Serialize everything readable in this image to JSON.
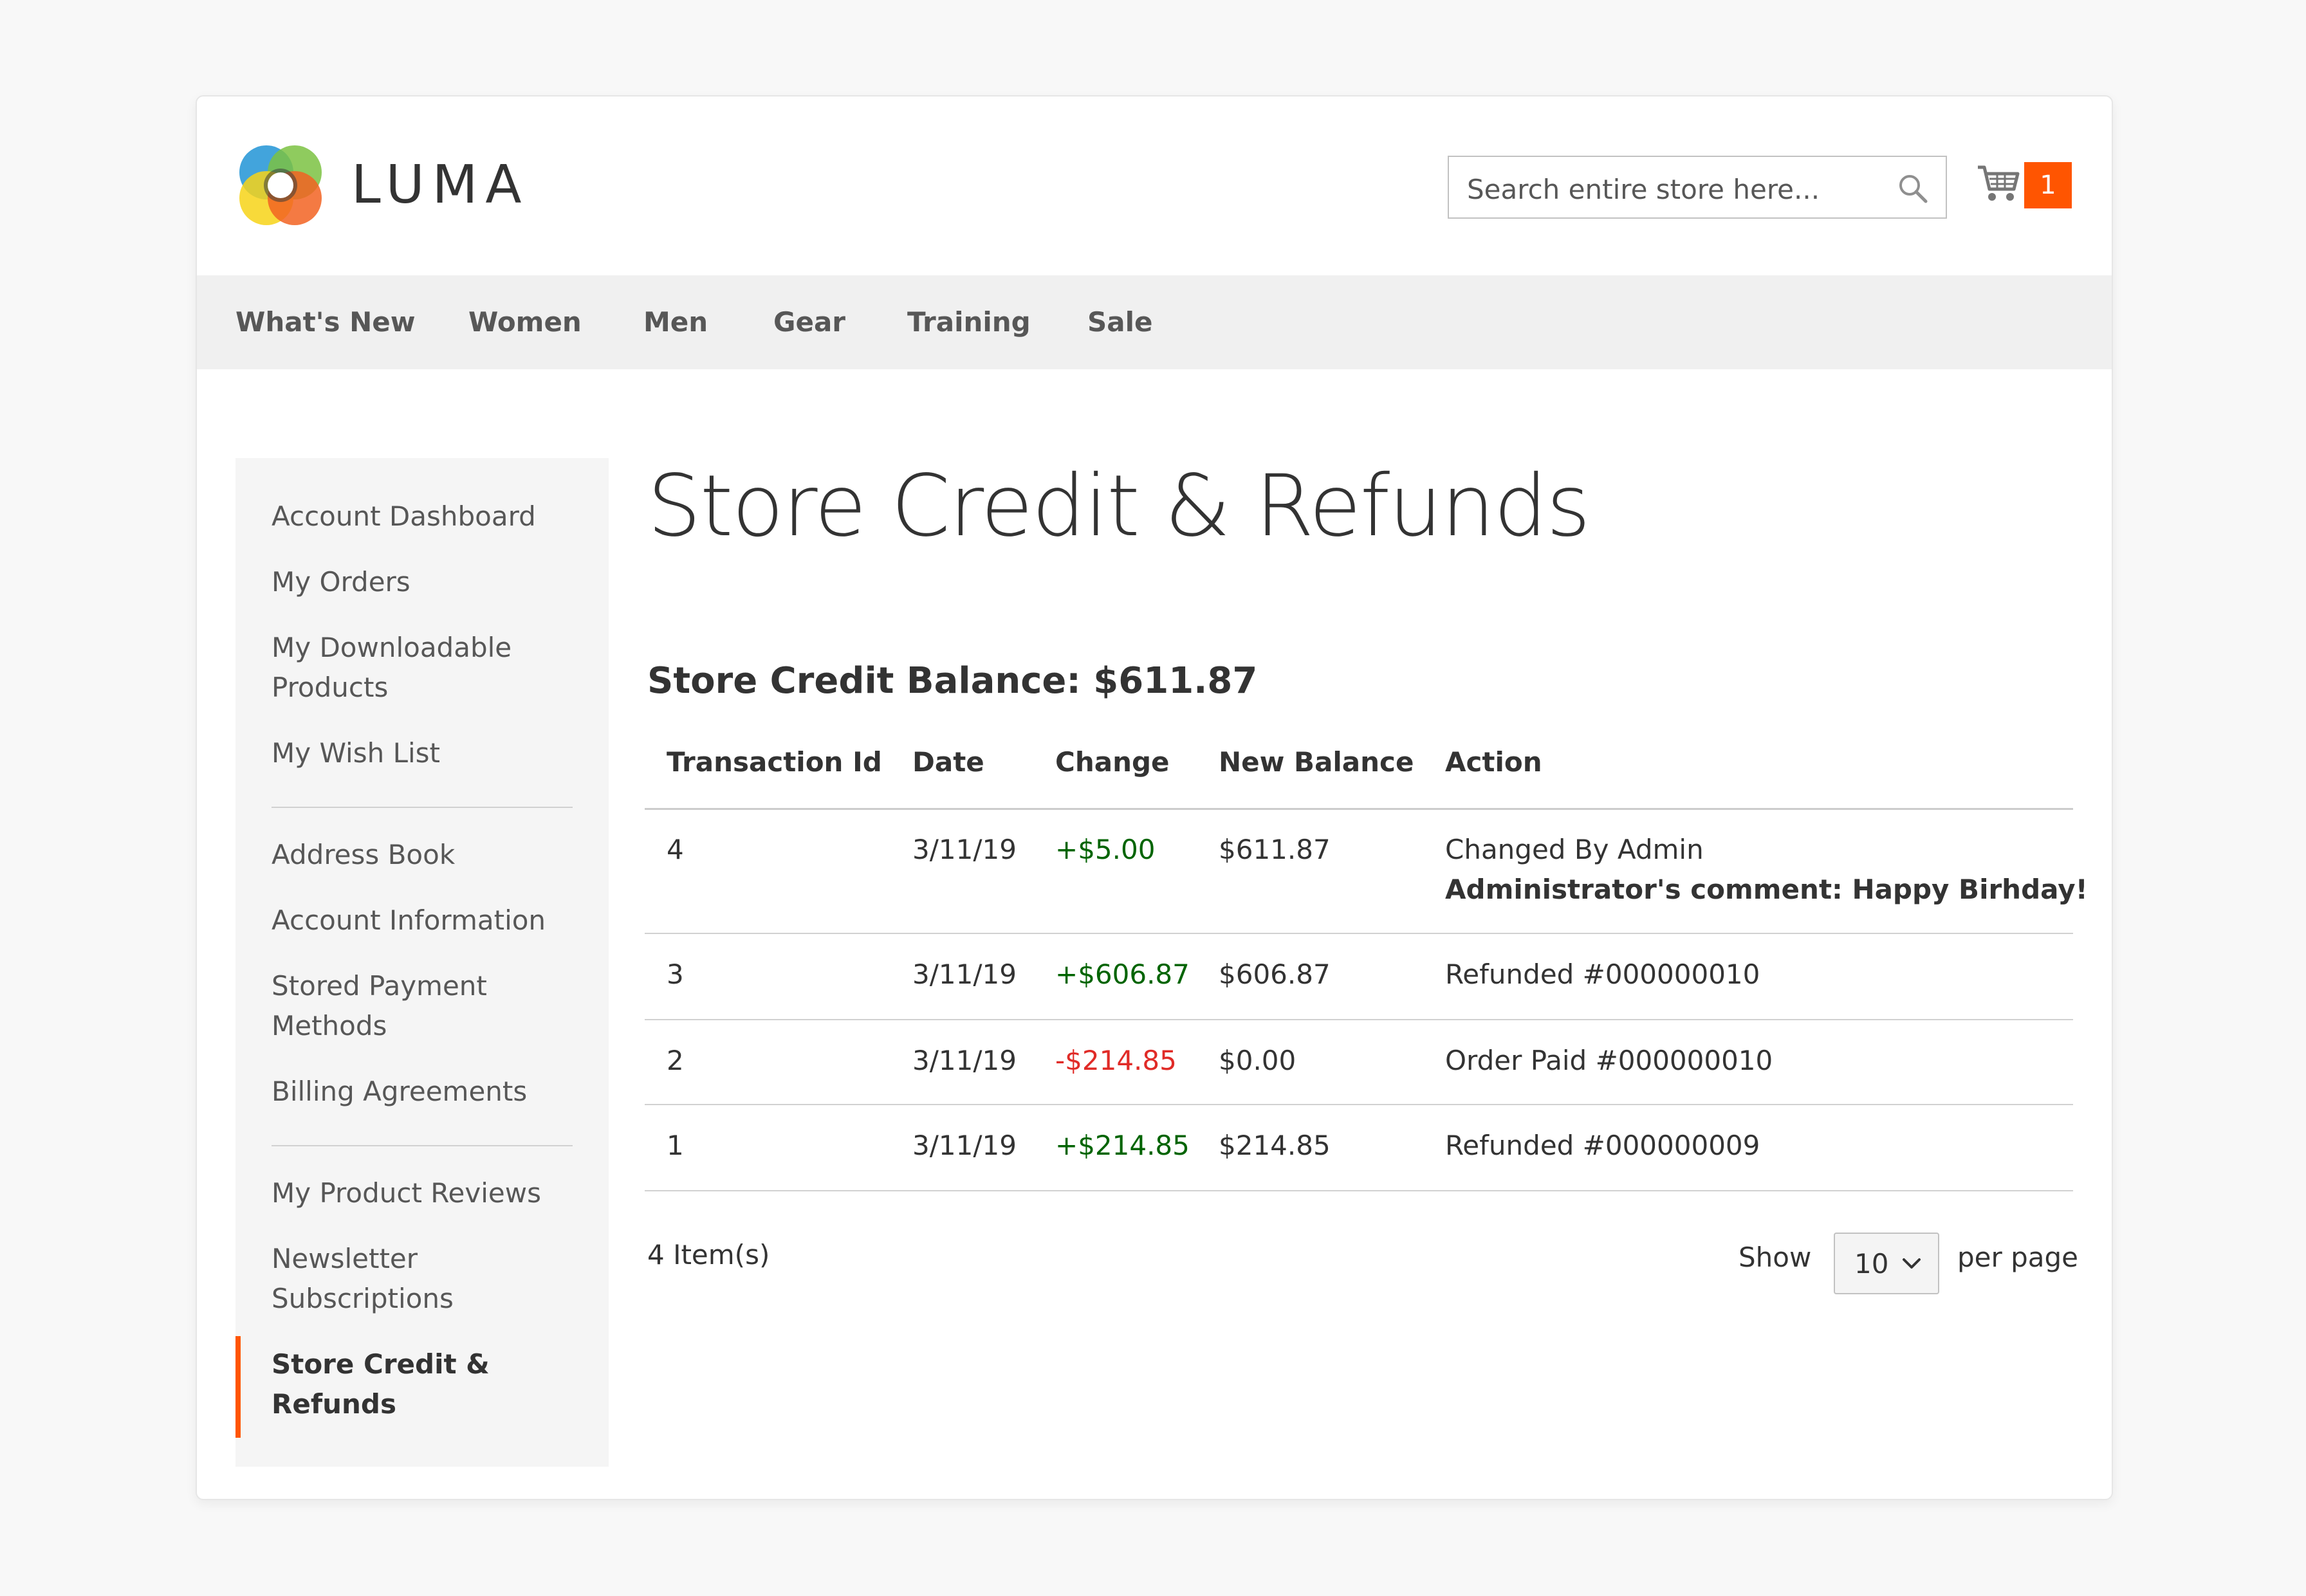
{
  "header": {
    "brand": "LUMA",
    "logo_icon": "luma-logo",
    "search_placeholder": "Search entire store here...",
    "search_icon": "search-icon",
    "cart_icon": "cart-icon",
    "cart_count": "1",
    "accent_color": "#ff5501"
  },
  "nav": {
    "items": [
      {
        "label": "What's New"
      },
      {
        "label": "Women"
      },
      {
        "label": "Men"
      },
      {
        "label": "Gear"
      },
      {
        "label": "Training"
      },
      {
        "label": "Sale"
      }
    ]
  },
  "sidebar": {
    "items": [
      {
        "label": "Account Dashboard"
      },
      {
        "label": "My Orders"
      },
      {
        "label": "My Downloadable Products"
      },
      {
        "label": "My Wish List"
      },
      {
        "label": "Address Book"
      },
      {
        "label": "Account Information"
      },
      {
        "label": "Stored Payment Methods"
      },
      {
        "label": "Billing Agreements"
      },
      {
        "label": "My Product Reviews"
      },
      {
        "label": "Newsletter Subscriptions"
      },
      {
        "label": "Store Credit & Refunds"
      }
    ],
    "active_index": 10
  },
  "main": {
    "title": "Store Credit & Refunds",
    "balance": "Store Credit Balance: $611.87",
    "table": {
      "headers": [
        "Transaction Id",
        "Date",
        "Change",
        "New Balance",
        "Action"
      ],
      "rows": [
        {
          "id": "4",
          "date": "3/11/19",
          "change": "+$5.00",
          "change_sign": "positive",
          "new_balance": "$611.87",
          "action": "Changed By Admin",
          "comment": "Administrator's comment: Happy Birhday!"
        },
        {
          "id": "3",
          "date": "3/11/19",
          "change": "+$606.87",
          "change_sign": "positive",
          "new_balance": "$606.87",
          "action": "Refunded #000000010"
        },
        {
          "id": "2",
          "date": "3/11/19",
          "change": "-$214.85",
          "change_sign": "negative",
          "new_balance": "$0.00",
          "action": "Order Paid #000000010"
        },
        {
          "id": "1",
          "date": "3/11/19",
          "change": "+$214.85",
          "change_sign": "positive",
          "new_balance": "$214.85",
          "action": "Refunded #000000009"
        }
      ]
    },
    "items_count": "4 Item(s)",
    "pager": {
      "show_label": "Show",
      "limit_value": "10",
      "per_page_label": "per page"
    }
  }
}
